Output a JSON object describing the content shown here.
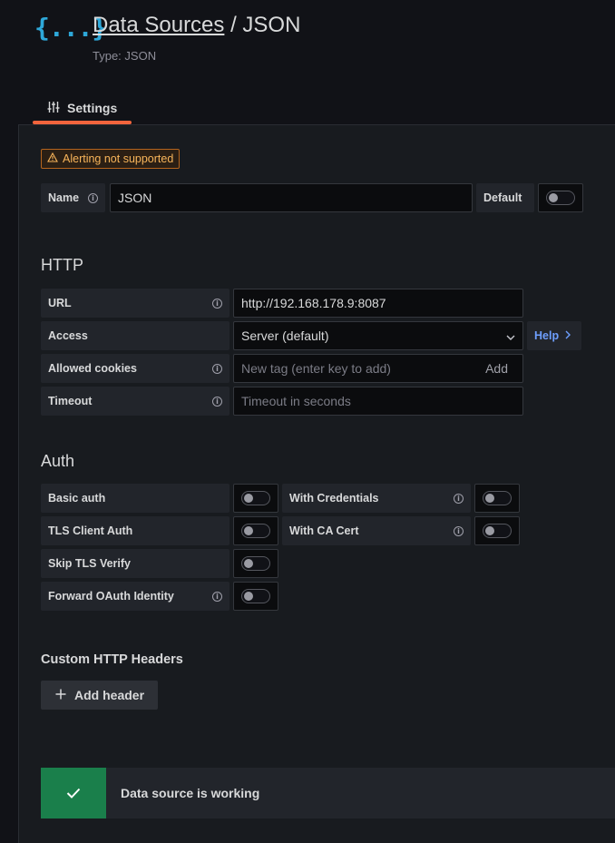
{
  "header": {
    "logo_text": "{...}",
    "breadcrumb_link": "Data Sources",
    "breadcrumb_separator": "/",
    "page_name": "JSON",
    "subtitle": "Type: JSON"
  },
  "tabs": [
    {
      "label": "Settings",
      "icon": "sliders-icon",
      "active": true
    }
  ],
  "alert_badge": {
    "text": "Alerting not supported",
    "icon": "warning-icon",
    "color": "#f8b55a"
  },
  "name_row": {
    "label": "Name",
    "value": "JSON",
    "default_label": "Default",
    "default_on": false
  },
  "http": {
    "title": "HTTP",
    "url_label": "URL",
    "url_value": "http://192.168.178.9:8087",
    "access_label": "Access",
    "access_value": "Server (default)",
    "help_label": "Help",
    "cookies_label": "Allowed cookies",
    "cookies_placeholder": "New tag (enter key to add)",
    "cookies_add": "Add",
    "timeout_label": "Timeout",
    "timeout_placeholder": "Timeout in seconds"
  },
  "auth": {
    "title": "Auth",
    "basic_auth": "Basic auth",
    "with_credentials": "With Credentials",
    "tls_client_auth": "TLS Client Auth",
    "with_ca_cert": "With CA Cert",
    "skip_tls_verify": "Skip TLS Verify",
    "forward_oauth": "Forward OAuth Identity"
  },
  "custom_headers": {
    "title": "Custom HTTP Headers",
    "add_button": "Add header"
  },
  "status": {
    "text": "Data source is working",
    "icon": "check-icon",
    "color": "#1a7f4b"
  }
}
